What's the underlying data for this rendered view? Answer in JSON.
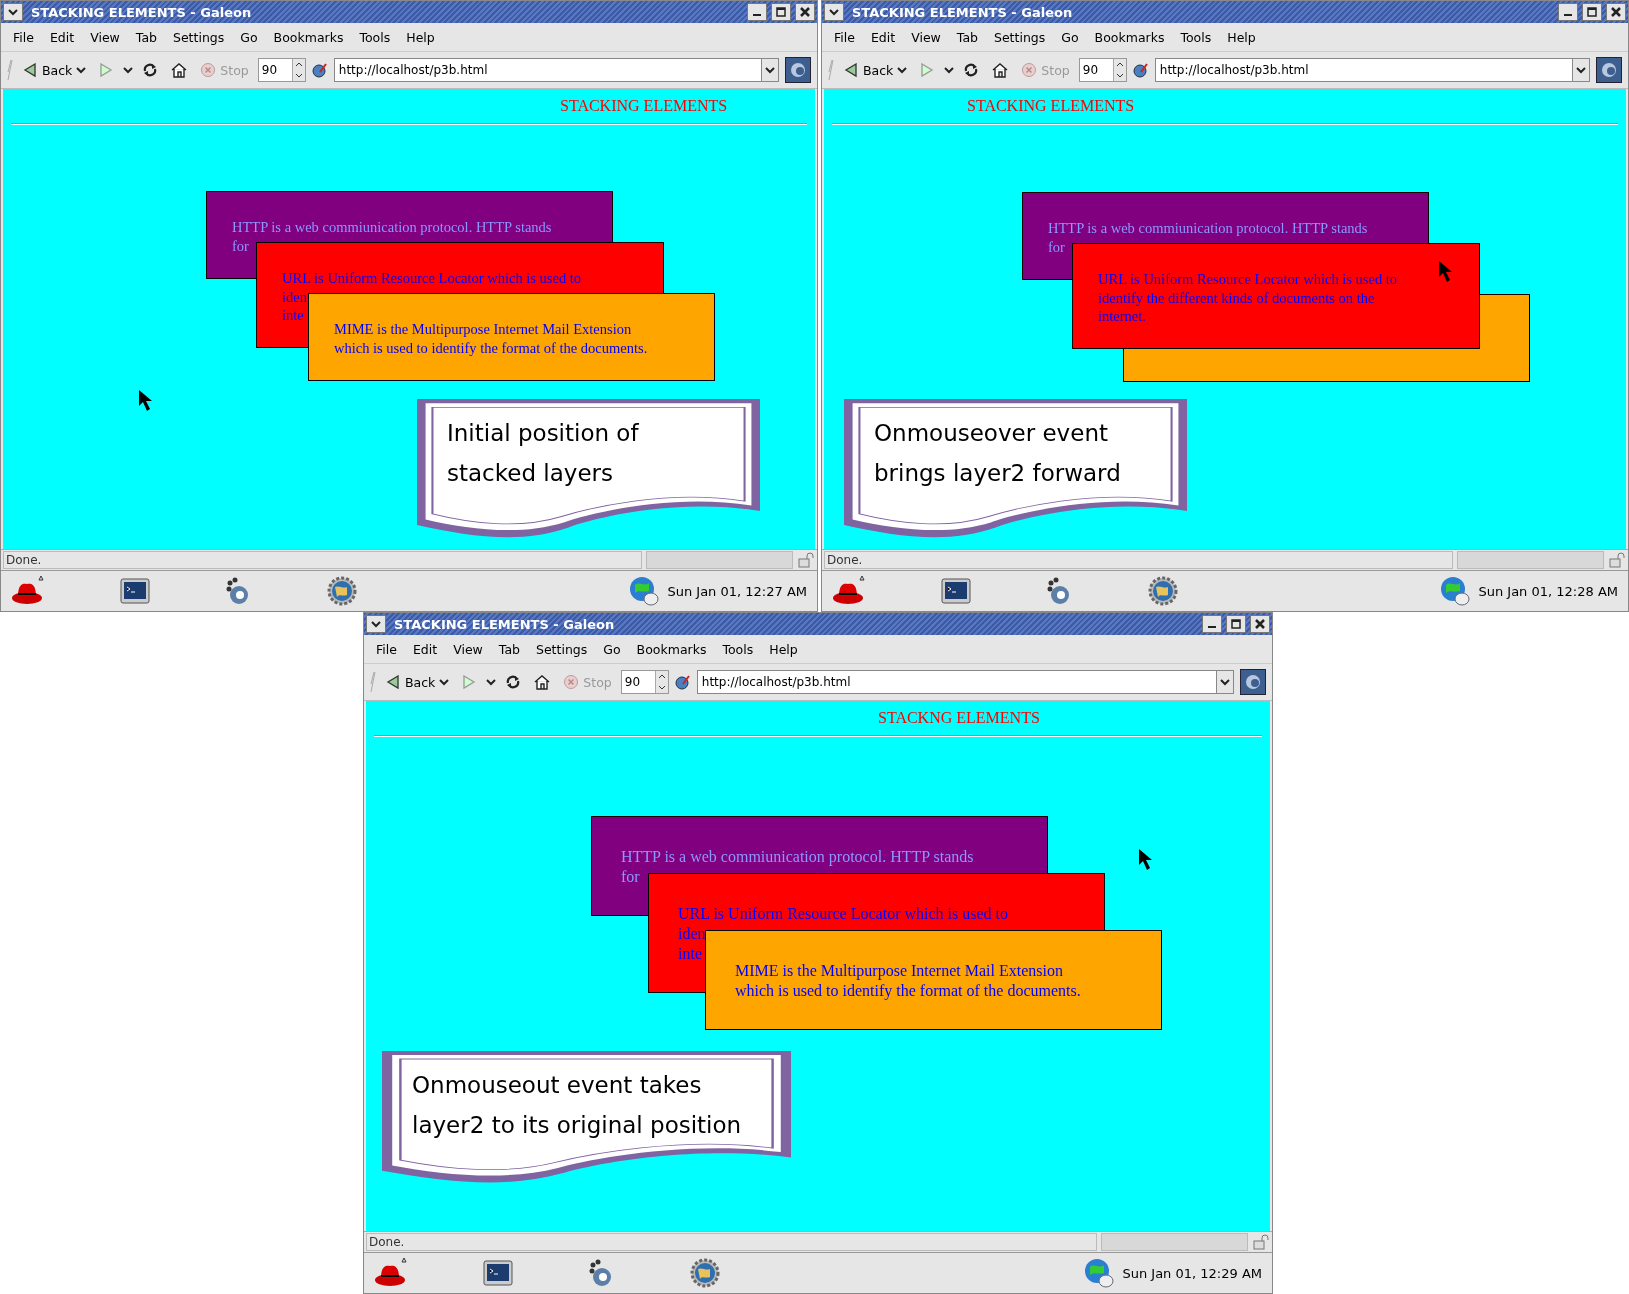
{
  "windows": [
    {
      "title": "STACKING ELEMENTS - Galeon",
      "menu": [
        "File",
        "Edit",
        "View",
        "Tab",
        "Settings",
        "Go",
        "Bookmarks",
        "Tools",
        "Help"
      ],
      "toolbar": {
        "back": "Back",
        "stop": {
          "label": "Stop",
          "disabled": true
        },
        "zoom": "90",
        "url": "http://localhost/p3b.html"
      },
      "page": {
        "heading": "STACKING ELEMENTS",
        "layers": [
          {
            "kind": "http",
            "lines": [
              "HTTP is a web commiunication protocol. HTTP stands",
              "for"
            ],
            "color": "#800080"
          },
          {
            "kind": "url",
            "lines": [
              "URL is Uniform Resource Locator which is used to",
              "iden",
              "inte"
            ],
            "color": "#ff0000"
          },
          {
            "kind": "mime",
            "lines": [
              "MIME is the Multipurpose Internet Mail Extension",
              "which is used to identify the format of the documents."
            ],
            "color": "#ffa500"
          }
        ],
        "callout": [
          "Initial position of",
          "stacked layers"
        ]
      },
      "status": "Done.",
      "clock": "Sun Jan 01, 12:27 AM"
    },
    {
      "title": "STACKING ELEMENTS - Galeon",
      "menu": [
        "File",
        "Edit",
        "View",
        "Tab",
        "Settings",
        "Go",
        "Bookmarks",
        "Tools",
        "Help"
      ],
      "toolbar": {
        "back": "Back",
        "stop": {
          "label": "Stop",
          "disabled": true
        },
        "zoom": "90",
        "url": "http://localhost/p3b.html"
      },
      "page": {
        "heading": "STACKING ELEMENTS",
        "layers": [
          {
            "kind": "http",
            "lines": [
              "HTTP is a web commiunication protocol. HTTP stands",
              "for"
            ],
            "color": "#800080"
          },
          {
            "kind": "mime",
            "color": "#ffa500"
          },
          {
            "kind": "url",
            "lines": [
              "URL is Uniform Resource Locator which is used to",
              "identify the different kinds of documents on the",
              "internet."
            ],
            "color": "#ff0000"
          }
        ],
        "callout": [
          "Onmouseover event",
          "brings layer2 forward"
        ]
      },
      "status": "Done.",
      "clock": "Sun Jan 01, 12:28 AM"
    },
    {
      "title": "STACKING ELEMENTS - Galeon",
      "menu": [
        "File",
        "Edit",
        "View",
        "Tab",
        "Settings",
        "Go",
        "Bookmarks",
        "Tools",
        "Help"
      ],
      "toolbar": {
        "back": "Back",
        "stop": {
          "label": "Stop",
          "disabled": true
        },
        "zoom": "90",
        "url": "http://localhost/p3b.html"
      },
      "page": {
        "heading": "STACKNG ELEMENTS",
        "layers": [
          {
            "kind": "http",
            "lines": [
              "HTTP is a web commiunication protocol. HTTP stands",
              "for"
            ],
            "color": "#800080"
          },
          {
            "kind": "url",
            "lines": [
              "URL is Uniform Resource Locator which is used to",
              "iden",
              "inte"
            ],
            "color": "#ff0000"
          },
          {
            "kind": "mime",
            "lines": [
              "MIME is the Multipurpose Internet Mail Extension",
              "which is used to identify the format of the documents."
            ],
            "color": "#ffa500"
          }
        ],
        "callout": [
          "Onmouseout event takes",
          "layer2 to its original position"
        ]
      },
      "status": "Done.",
      "clock": "Sun Jan 01, 12:29 AM"
    }
  ]
}
